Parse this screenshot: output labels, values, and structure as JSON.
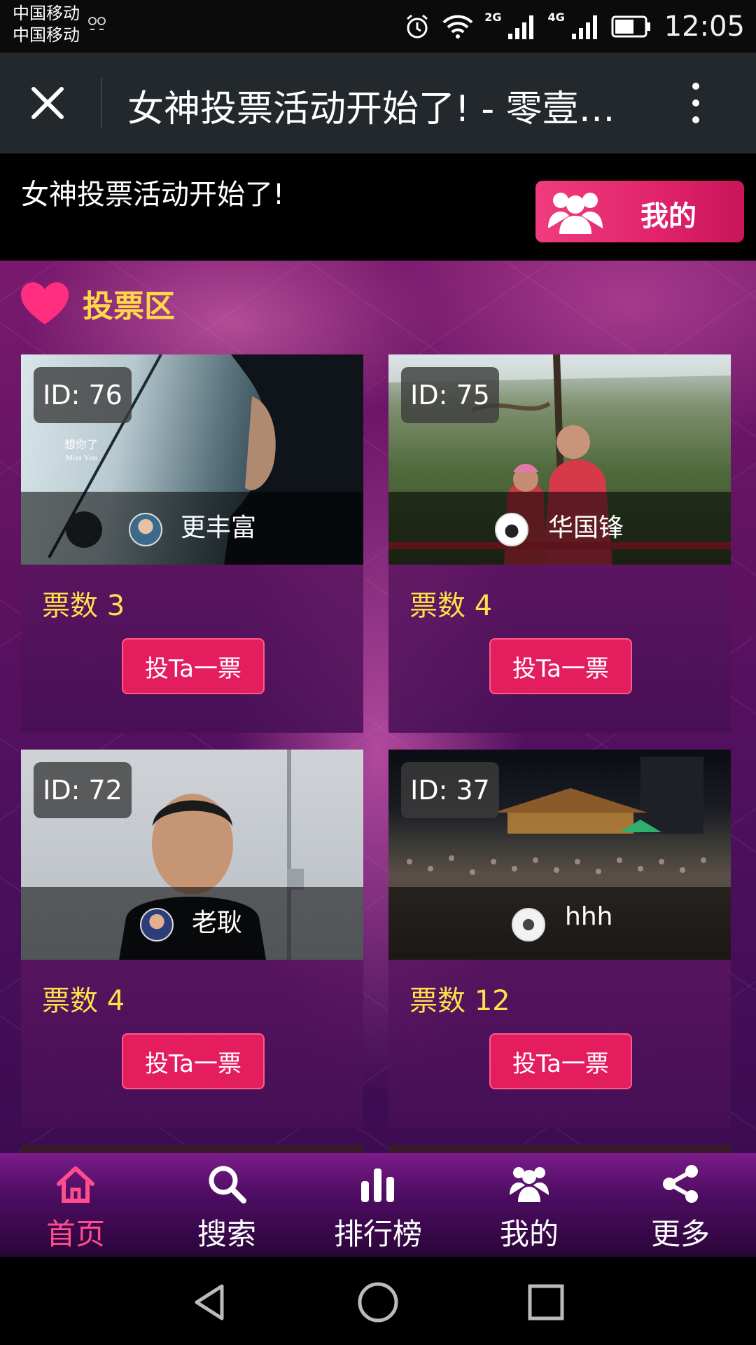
{
  "status_bar": {
    "carrier_1": "中国移动",
    "carrier_2": "中国移动",
    "network_1": "2G",
    "network_2": "4G",
    "time": "12:05"
  },
  "title_bar": {
    "title": "女神投票活动开始了! - 零壹…"
  },
  "header": {
    "title": "女神投票活动开始了!",
    "mine_button": "我的"
  },
  "section": {
    "title": "投票区"
  },
  "cards": [
    {
      "id": "ID: 76",
      "name": "更丰富",
      "votes": "票数 3",
      "button": "投Ta一票",
      "photo_caption_1": "想你了",
      "photo_caption_2": "Miss You"
    },
    {
      "id": "ID: 75",
      "name": "华国锋",
      "votes": "票数 4",
      "button": "投Ta一票"
    },
    {
      "id": "ID: 72",
      "name": "老耿",
      "votes": "票数 4",
      "button": "投Ta一票"
    },
    {
      "id": "ID: 37",
      "name": "hhh",
      "votes": "票数 12",
      "button": "投Ta一票"
    }
  ],
  "tabs": [
    {
      "label": "首页",
      "icon": "home-icon",
      "active": true
    },
    {
      "label": "搜索",
      "icon": "search-icon",
      "active": false
    },
    {
      "label": "排行榜",
      "icon": "bar-chart-icon",
      "active": false
    },
    {
      "label": "我的",
      "icon": "users-icon",
      "active": false
    },
    {
      "label": "更多",
      "icon": "share-icon",
      "active": false
    }
  ],
  "colors": {
    "accent_pink": "#e41e5e",
    "votes_yellow": "#ffe04a",
    "active_tab": "#ff4d8d"
  }
}
